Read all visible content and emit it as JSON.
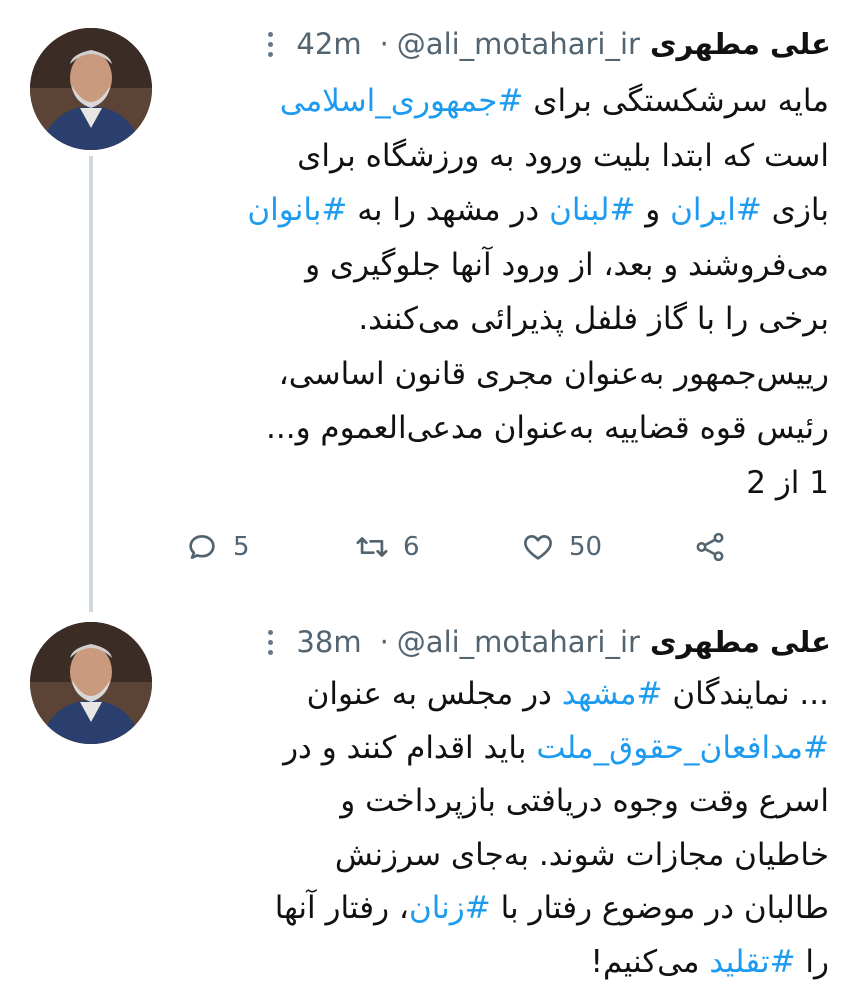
{
  "tweets": [
    {
      "display_name": "علی مطهری",
      "handle": "@ali_motahari_ir",
      "separator": "·",
      "time": "42m",
      "lines": [
        [
          {
            "t": "مایه سرشکستگی برای "
          },
          {
            "t": "#جمهوری_اسلامی",
            "h": true
          }
        ],
        [
          {
            "t": "است که ابتدا بلیت ورود به ورزشگاه برای"
          }
        ],
        [
          {
            "t": "بازی "
          },
          {
            "t": "#ایران",
            "h": true
          },
          {
            "t": " و "
          },
          {
            "t": "#لبنان",
            "h": true
          },
          {
            "t": " در مشهد را به "
          },
          {
            "t": "#بانوان",
            "h": true
          }
        ],
        [
          {
            "t": "می‌فروشند و بعد، از ورود آنها جلوگیری و"
          }
        ],
        [
          {
            "t": "برخی را با گاز فلفل پذیرائی می‌کنند."
          }
        ],
        [
          {
            "t": "رییس‌جمهور به‌عنوان مجری قانون اساسی،"
          }
        ],
        [
          {
            "t": "رئیس قوه قضاییه به‌عنوان مدعی‌العموم و..."
          }
        ],
        [
          {
            "t": "1 از 2"
          }
        ]
      ],
      "actions": {
        "replies": "5",
        "retweets": "6",
        "likes": "50"
      }
    },
    {
      "display_name": "علی مطهری",
      "handle": "@ali_motahari_ir",
      "separator": "·",
      "time": "38m",
      "lines": [
        [
          {
            "t": "... نمایندگان "
          },
          {
            "t": "#مشهد",
            "h": true
          },
          {
            "t": " در مجلس به عنوان"
          }
        ],
        [
          {
            "t": "#مدافعان_حقوق_ملت",
            "h": true
          },
          {
            "t": " باید اقدام کنند و در"
          }
        ],
        [
          {
            "t": "اسرع وقت وجوه دریافتی بازپرداخت و"
          }
        ],
        [
          {
            "t": "خاطیان مجازات شوند. به‌جای سرزنش"
          }
        ],
        [
          {
            "t": "طالبان در موضوع رفتار با "
          },
          {
            "t": "#زنان",
            "h": true
          },
          {
            "t": "، رفتار آنها"
          }
        ],
        [
          {
            "t": "را "
          },
          {
            "t": "#تقلید",
            "h": true
          },
          {
            "t": " می‌کنیم!"
          }
        ]
      ]
    }
  ],
  "icons": {
    "more": "more-vertical-icon",
    "reply": "reply-icon",
    "retweet": "retweet-icon",
    "like": "heart-icon",
    "share": "share-icon"
  },
  "colors": {
    "hashtag": "#1d9bf0",
    "muted": "#536471",
    "thread_line": "#cfd6dc"
  }
}
